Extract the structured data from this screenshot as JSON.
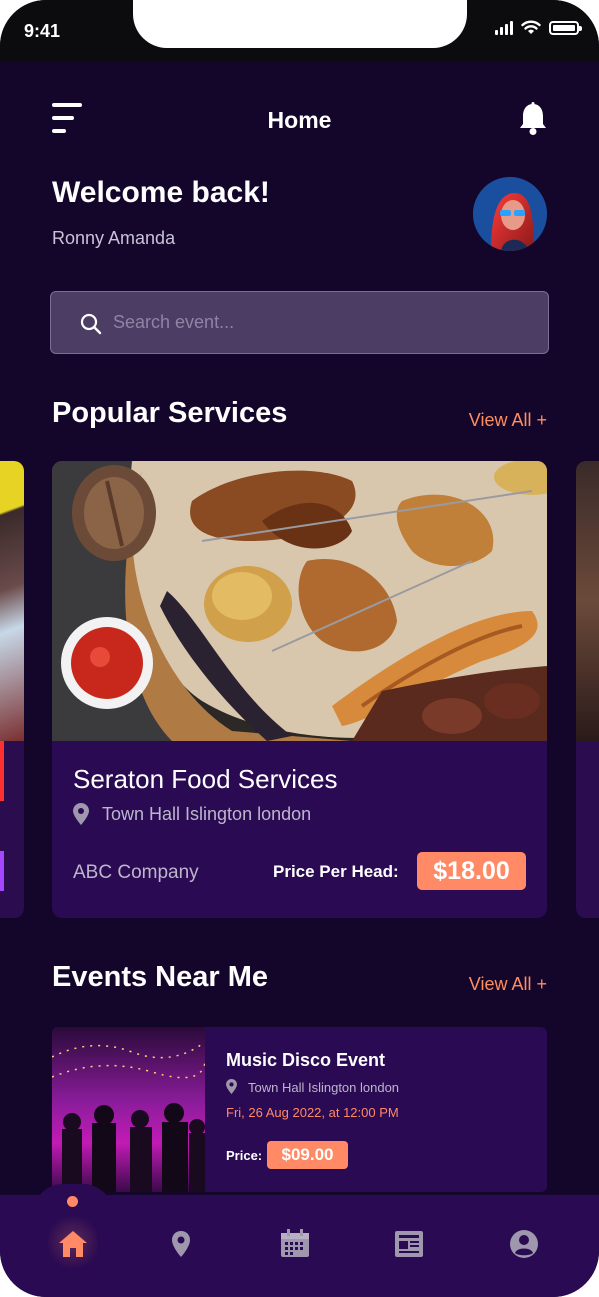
{
  "status_bar": {
    "time": "9:41"
  },
  "header": {
    "title": "Home"
  },
  "welcome": {
    "heading": "Welcome back!",
    "username": "Ronny Amanda"
  },
  "search": {
    "placeholder": "Search event..."
  },
  "popular": {
    "title": "Popular Services",
    "view_all": "View All +",
    "card": {
      "name": "Seraton Food Services",
      "location": "Town Hall Islington london",
      "company": "ABC Company",
      "price_label": "Price Per Head:",
      "price": "$18.00"
    }
  },
  "events": {
    "title": "Events Near Me",
    "view_all": "View All +",
    "item": {
      "title": "Music Disco Event",
      "location": "Town Hall Islington london",
      "date": "Fri, 26 Aug 2022,  at 12:00 PM",
      "price_label": "Price:",
      "price": "$09.00"
    }
  },
  "tabbar": {
    "items": [
      {
        "icon": "home-icon",
        "active": true
      },
      {
        "icon": "map-pin-icon",
        "active": false
      },
      {
        "icon": "calendar-icon",
        "active": false
      },
      {
        "icon": "news-icon",
        "active": false
      },
      {
        "icon": "profile-icon",
        "active": false
      }
    ]
  },
  "colors": {
    "background": "#14052b",
    "card": "#2a0a52",
    "accent": "#ff8a65",
    "search_bg": "#4b3d63"
  }
}
